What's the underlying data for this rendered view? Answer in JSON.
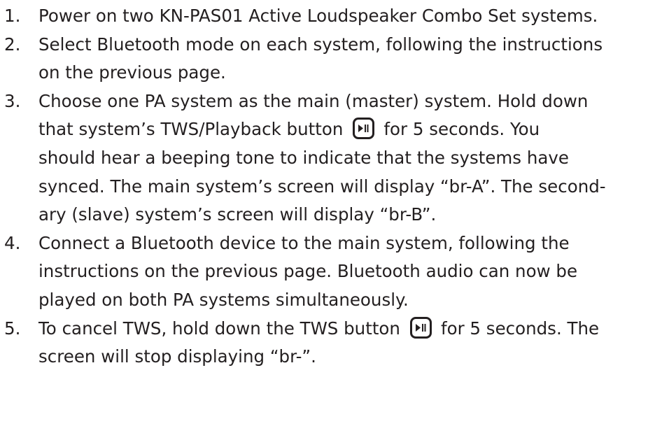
{
  "steps": [
    {
      "number": "1.",
      "lines": [
        {
          "text": "Power on two KN-PAS01 Active Loudspeaker Combo Set systems."
        }
      ]
    },
    {
      "number": "2.",
      "lines": [
        {
          "text": "Select Bluetooth mode on each system, following the instructions"
        },
        {
          "text": "on the previous page."
        }
      ]
    },
    {
      "number": "3.",
      "lines": [
        {
          "text": "Choose one PA system as the main (master) system. Hold down"
        },
        {
          "before": "that system’s TWS/Playback button",
          "icon": "play-pause-icon",
          "after": "for 5 seconds. You"
        },
        {
          "text": "should hear a beeping tone to indicate that the systems have"
        },
        {
          "text": "synced. The main system’s screen will display “br-A”. The second-"
        },
        {
          "text": "ary (slave) system’s screen will display “br-B”."
        }
      ]
    },
    {
      "number": "4.",
      "lines": [
        {
          "text": "Connect a Bluetooth device to the main system, following the"
        },
        {
          "text": "instructions on the previous page. Bluetooth audio can now be"
        },
        {
          "text": "played on both PA systems simultaneously."
        }
      ]
    },
    {
      "number": "5.",
      "lines": [
        {
          "before": "To cancel TWS, hold down the TWS button",
          "icon": "play-pause-icon",
          "after": "for 5 seconds. The"
        },
        {
          "text": "screen will stop displaying “br-”."
        }
      ]
    }
  ]
}
